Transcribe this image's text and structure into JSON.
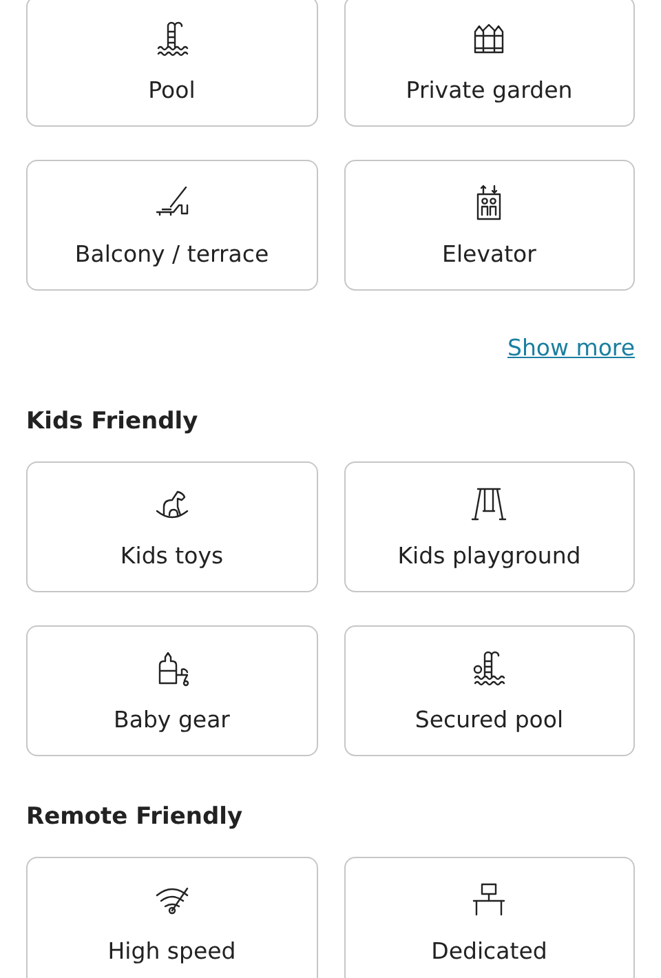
{
  "sections": [
    {
      "items": [
        {
          "label": "Pool"
        },
        {
          "label": "Private garden"
        },
        {
          "label": "Balcony / terrace"
        },
        {
          "label": "Elevator"
        }
      ],
      "more_link": "Show more"
    },
    {
      "title": "Kids Friendly",
      "items": [
        {
          "label": "Kids toys"
        },
        {
          "label": "Kids playground"
        },
        {
          "label": "Baby gear"
        },
        {
          "label": "Secured pool"
        }
      ]
    },
    {
      "title": "Remote Friendly",
      "items": [
        {
          "label": "High speed"
        },
        {
          "label": "Dedicated"
        }
      ]
    }
  ]
}
